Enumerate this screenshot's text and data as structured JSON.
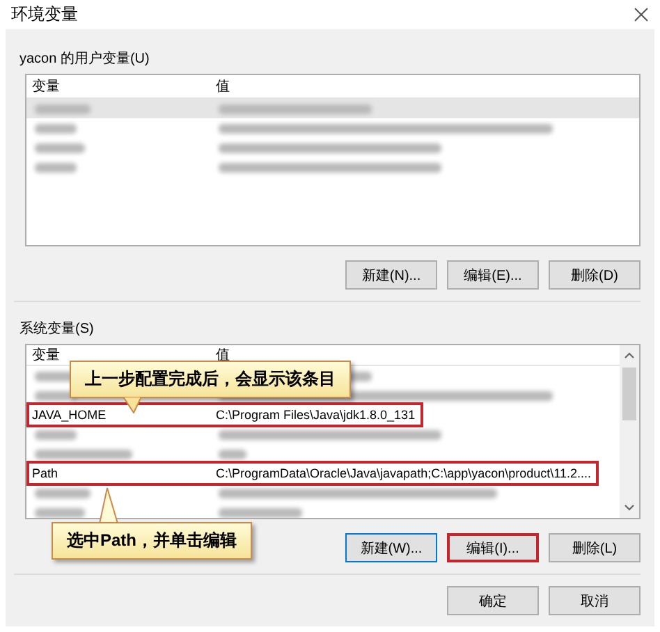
{
  "window": {
    "title": "环境变量"
  },
  "user_variables": {
    "label": "yacon 的用户变量(U)",
    "columns": [
      "变量",
      "值"
    ],
    "rows": [
      {
        "kind": "blurred",
        "selected": true,
        "annotated": false
      },
      {
        "kind": "blurred",
        "selected": false,
        "annotated": false
      },
      {
        "kind": "blurred",
        "selected": false,
        "annotated": false
      },
      {
        "kind": "blurred",
        "selected": false,
        "annotated": false
      }
    ],
    "buttons": [
      {
        "label": "新建(N)...",
        "focused": false,
        "annotated": false
      },
      {
        "label": "编辑(E)...",
        "focused": false,
        "annotated": false
      },
      {
        "label": "删除(D)",
        "focused": false,
        "annotated": false
      }
    ]
  },
  "system_variables": {
    "label": "系统变量(S)",
    "columns": [
      "变量",
      "值"
    ],
    "rows": [
      {
        "kind": "blurred",
        "selected": false,
        "annotated": false
      },
      {
        "kind": "blurred",
        "selected": false,
        "annotated": false
      },
      {
        "kind": "text",
        "name": "JAVA_HOME",
        "value": "C:\\Program Files\\Java\\jdk1.8.0_131",
        "selected": false,
        "annotated": true
      },
      {
        "kind": "blurred",
        "selected": false,
        "annotated": false
      },
      {
        "kind": "blurred",
        "selected": false,
        "annotated": false
      },
      {
        "kind": "text",
        "name": "Path",
        "value": "C:\\ProgramData\\Oracle\\Java\\javapath;C:\\app\\yacon\\product\\11.2....",
        "selected": false,
        "annotated": true
      },
      {
        "kind": "blurred",
        "selected": false,
        "annotated": false
      },
      {
        "kind": "blurred",
        "selected": false,
        "annotated": false
      }
    ],
    "buttons": [
      {
        "label": "新建(W)...",
        "focused": true,
        "annotated": false
      },
      {
        "label": "编辑(I)...",
        "focused": false,
        "annotated": true
      },
      {
        "label": "删除(L)",
        "focused": false,
        "annotated": false
      }
    ]
  },
  "footer_buttons": [
    "确定",
    "取消"
  ],
  "callouts": [
    {
      "text": "上一步配置完成后，会显示该条目"
    },
    {
      "text": "选中Path，并单击编辑"
    }
  ]
}
